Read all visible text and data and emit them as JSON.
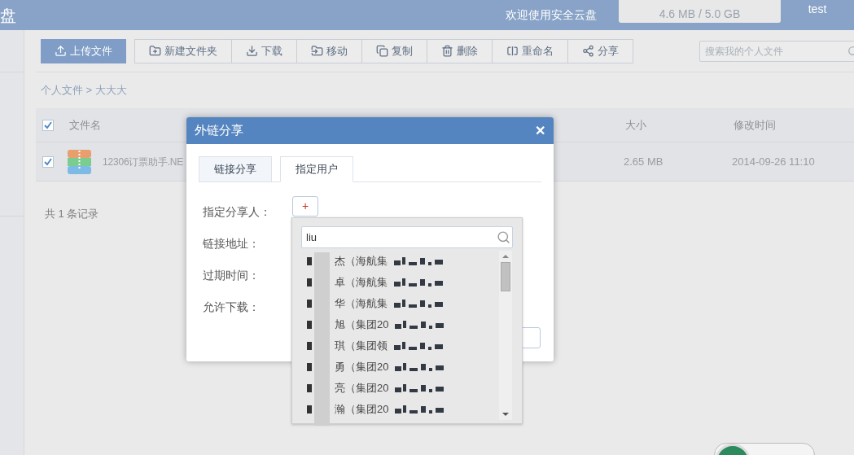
{
  "header": {
    "logo_fragment": "盘",
    "welcome": "欢迎使用安全云盘",
    "quota": "4.6 MB / 5.0 GB",
    "user": "test"
  },
  "toolbar": {
    "buttons": [
      {
        "label": "上传文件",
        "kind": "upload",
        "primary": true
      },
      {
        "label": "新建文件夹",
        "kind": "folder",
        "primary": false
      },
      {
        "label": "下载",
        "kind": "download",
        "primary": false
      },
      {
        "label": "移动",
        "kind": "move",
        "primary": false
      },
      {
        "label": "复制",
        "kind": "copy",
        "primary": false
      },
      {
        "label": "删除",
        "kind": "delete",
        "primary": false
      },
      {
        "label": "重命名",
        "kind": "rename",
        "primary": false
      },
      {
        "label": "分享",
        "kind": "share",
        "primary": false
      }
    ],
    "search": {
      "placeholder": "搜索我的个人文件"
    }
  },
  "breadcrumb": "个人文件 > 大大大",
  "table": {
    "columns": [
      "文件名",
      "大小",
      "修改时间"
    ],
    "header_checked": true,
    "rows": [
      {
        "name": "12306订票助手.NE",
        "size": "2.65 MB",
        "modified": "2014-09-26 11:10",
        "checked": true
      }
    ]
  },
  "record_count": "共 1 条记录",
  "dialog": {
    "title": "外链分享",
    "close": "✕",
    "tabs": [
      {
        "label": "链接分享",
        "selected": false
      },
      {
        "label": "指定用户",
        "selected": true
      }
    ],
    "fields": [
      "指定分享人：",
      "链接地址：",
      "过期时间：",
      "允许下载："
    ],
    "add_button": "+",
    "picker": {
      "value": "liu",
      "items": [
        "杰（海航集",
        "卓（海航集",
        "华（海航集",
        "旭（集团20",
        "琪（集团领",
        "勇（集团20",
        "亮（集团20",
        "瀚（集团20"
      ]
    }
  }
}
